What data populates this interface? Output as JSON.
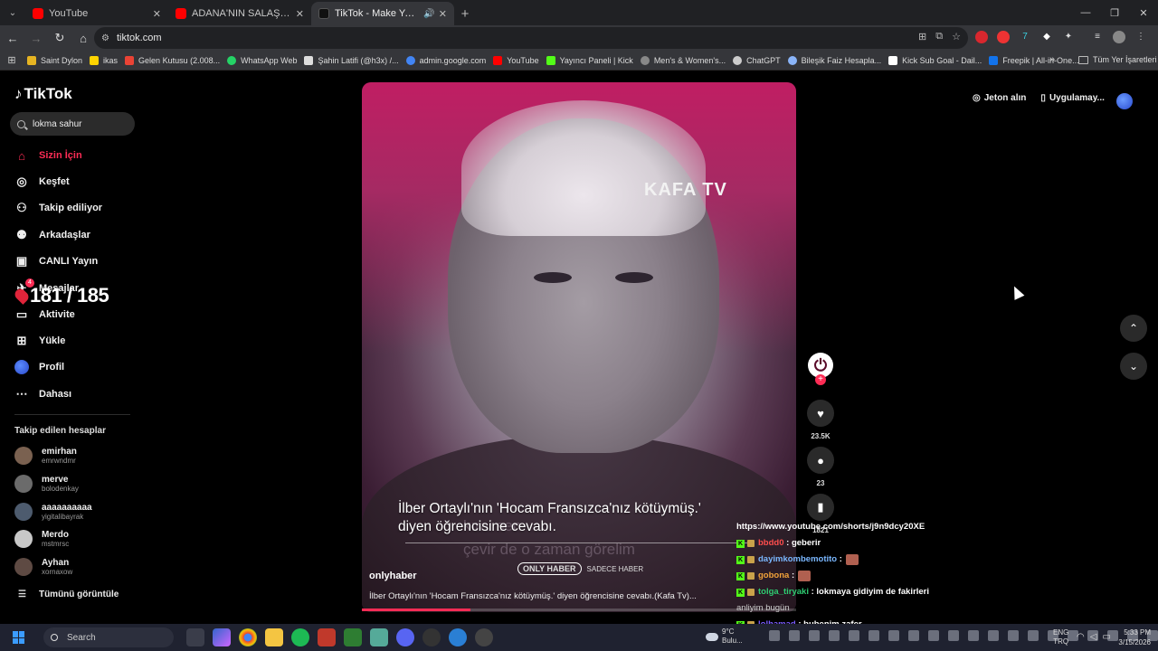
{
  "browser": {
    "tabs": [
      {
        "title": "YouTube",
        "favicon_color": "#ff0000",
        "active": false
      },
      {
        "title": "ADANA'NIN SALAŞ KEBAPÇILAR",
        "favicon_color": "#ff0000",
        "active": false
      },
      {
        "title": "TikTok - Make Your Day",
        "favicon_color": "#111111",
        "active": true
      }
    ],
    "url": "tiktok.com",
    "bookmarks": [
      {
        "label": "Saint Dylon",
        "color": "#e6b422"
      },
      {
        "label": "ikas",
        "color": "#ffd400"
      },
      {
        "label": "Gelen Kutusu (2.008...",
        "color": "#ea4335"
      },
      {
        "label": "WhatsApp Web",
        "color": "#25d366"
      },
      {
        "label": "Şahin Latifi (@h3x) /...",
        "color": "#dddddd"
      },
      {
        "label": "admin.google.com",
        "color": "#4285f4"
      },
      {
        "label": "YouTube",
        "color": "#ff0000"
      },
      {
        "label": "Yayıncı Paneli | Kick",
        "color": "#53fc18"
      },
      {
        "label": "Men's & Women's...",
        "color": "#888888"
      },
      {
        "label": "ChatGPT",
        "color": "#cccccc"
      },
      {
        "label": "Bileşik Faiz Hesapla...",
        "color": "#8ab4f8"
      },
      {
        "label": "Kick Sub Goal - Dail...",
        "color": "#ffffff"
      },
      {
        "label": "Freepik | All-in-One...",
        "color": "#1273eb"
      }
    ],
    "bookmarks_all": "Tüm Yer İşaretleri"
  },
  "tiktok": {
    "logo": "TikTok",
    "search_value": "lokma sahur",
    "nav": [
      {
        "label": "Sizin İçin",
        "icon": "home-icon",
        "active": true
      },
      {
        "label": "Keşfet",
        "icon": "compass-icon"
      },
      {
        "label": "Takip ediliyor",
        "icon": "following-icon"
      },
      {
        "label": "Arkadaşlar",
        "icon": "friends-icon"
      },
      {
        "label": "CANLI Yayın",
        "icon": "live-icon"
      },
      {
        "label": "Mesajlar",
        "icon": "messages-icon"
      },
      {
        "label": "Aktivite",
        "icon": "activity-icon"
      },
      {
        "label": "Yükle",
        "icon": "upload-icon"
      },
      {
        "label": "Profil",
        "icon": "profile-icon"
      },
      {
        "label": "Dahası",
        "icon": "more-icon"
      }
    ],
    "messages_badge": "4",
    "overlay_counter": "181 / 185",
    "following_title": "Takip edilen hesaplar",
    "following": [
      {
        "name": "emirhan",
        "handle": "emrwndmr"
      },
      {
        "name": "merve",
        "handle": "bolodenkay"
      },
      {
        "name": "aaaaaaaaaa",
        "handle": "yigitalibayrak"
      },
      {
        "name": "Merdo",
        "handle": "mstmrsc"
      },
      {
        "name": "Ayhan",
        "handle": "xornaxow"
      }
    ],
    "see_all": "Tümünü görüntüle",
    "top_actions": {
      "coins": "Jeton alın",
      "app": "Uygulamay..."
    }
  },
  "video": {
    "watermark": "KAFA TV",
    "subtitle_line1": "İlber Ortaylı'nın 'Hocam Fransızca'nız kötüymüş.'",
    "subtitle_line2": "diyen öğrencisine cevabı.",
    "brand_only": "ONLY HABER",
    "brand_tag": "SADECE HABER",
    "author": "onlyhaber",
    "description": "İlber Ortaylı'nın 'Hocam Fransızca'nız kötüymüş.' diyen öğrencisine cevabı.(Kafa Tv)...",
    "progress": 0.25,
    "likes": "23.5K",
    "comments": "23",
    "saves": "1821"
  },
  "chat": [
    {
      "user": "",
      "msg": "https://www.youtube.com/shorts/j9n9dcy20XE",
      "user_color": "#ffffff"
    },
    {
      "user": "bbdd0",
      "msg": ": geberir",
      "user_color": "#ff4d4d"
    },
    {
      "user": "dayimkombemotito",
      "msg": ":",
      "user_color": "#7ab7ff"
    },
    {
      "user": "gobona",
      "msg": ":",
      "user_color": "#f2a33a"
    },
    {
      "user": "tolga_tiryaki",
      "msg": ": lokmaya gidiyim de fakirleri",
      "user_color": "#2ecc71"
    },
    {
      "user": "",
      "msg": "anliyim bugün",
      "user_color": "#ffffff"
    },
    {
      "user": "lolhamad",
      "msg": ": bubenim zafer",
      "user_color": "#7a5cff"
    }
  ],
  "taskbar": {
    "search": "Search",
    "weather": "9°C",
    "weather_desc": "Bulu...",
    "lang1": "ENG",
    "lang2": "TRQ",
    "time": "5:33 PM",
    "date": "3/15/2026"
  }
}
